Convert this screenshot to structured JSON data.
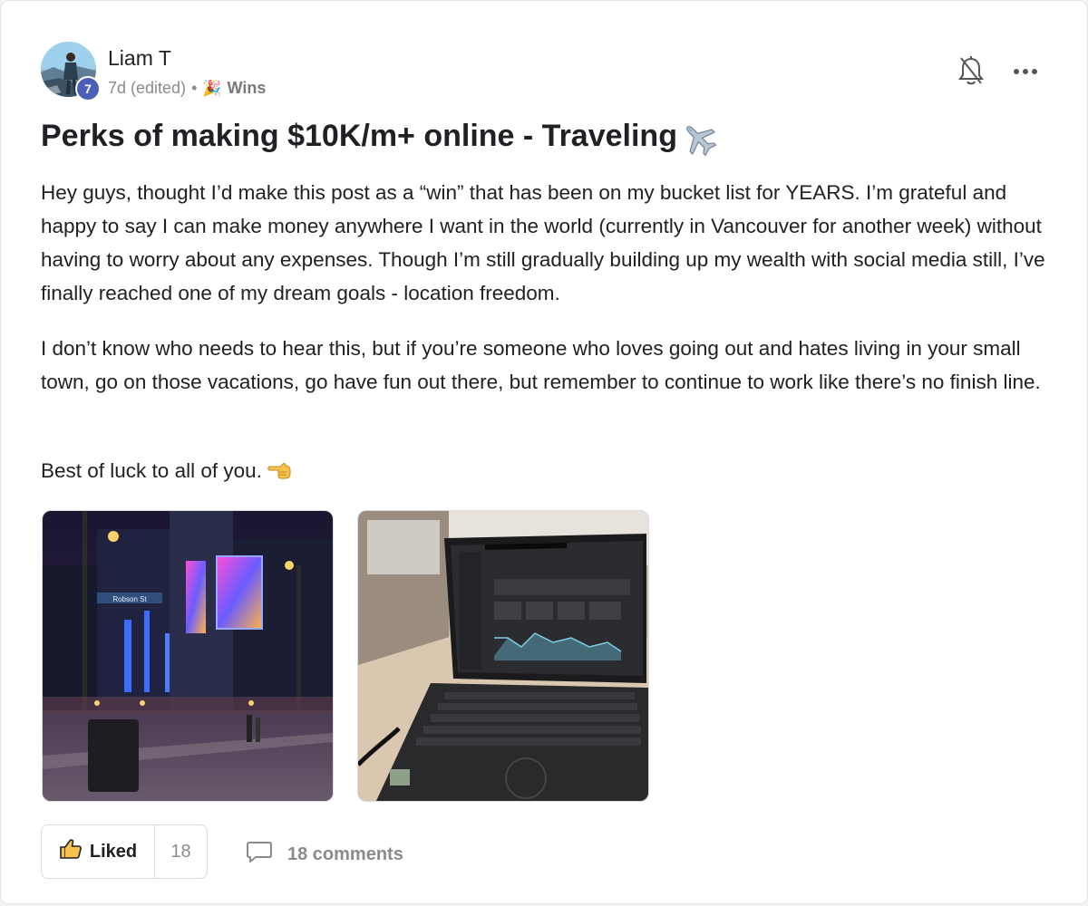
{
  "post": {
    "author": {
      "name": "Liam T",
      "level": "7"
    },
    "meta": {
      "time": "7d (edited)",
      "separator": "•",
      "category_emoji": "🎉",
      "category": "Wins"
    },
    "title": "Perks of making $10K/m+ online - Traveling",
    "title_emoji": "airplane-icon",
    "paragraphs": [
      "Hey guys, thought I’d make this post as a “win” that has been on my bucket list for YEARS. I’m grateful and happy to say I can make money anywhere I want in the world (currently in Vancouver for another week) without having to worry about any expenses. Though I’m still gradually building up my wealth with social media still, I’ve finally reached one of my dream goals - location freedom.",
      "I don’t know who needs to hear this, but if you’re someone who loves going out and hates living in your small town, go on those vacations, go have fun out there, but remember to continue to work like there’s no finish line.",
      "Best of luck to all of you."
    ],
    "closing_emoji": "pointing-hand-icon",
    "images": [
      {
        "name": "city-street-night-photo",
        "street_sign": "Robson St"
      },
      {
        "name": "laptop-analytics-photo"
      }
    ],
    "footer": {
      "like_label": "Liked",
      "like_count": "18",
      "comments_label": "18 comments"
    }
  },
  "colors": {
    "badge": "#4b5eb8",
    "muted_text": "#8b8b8b",
    "border": "#d9d9d9"
  }
}
